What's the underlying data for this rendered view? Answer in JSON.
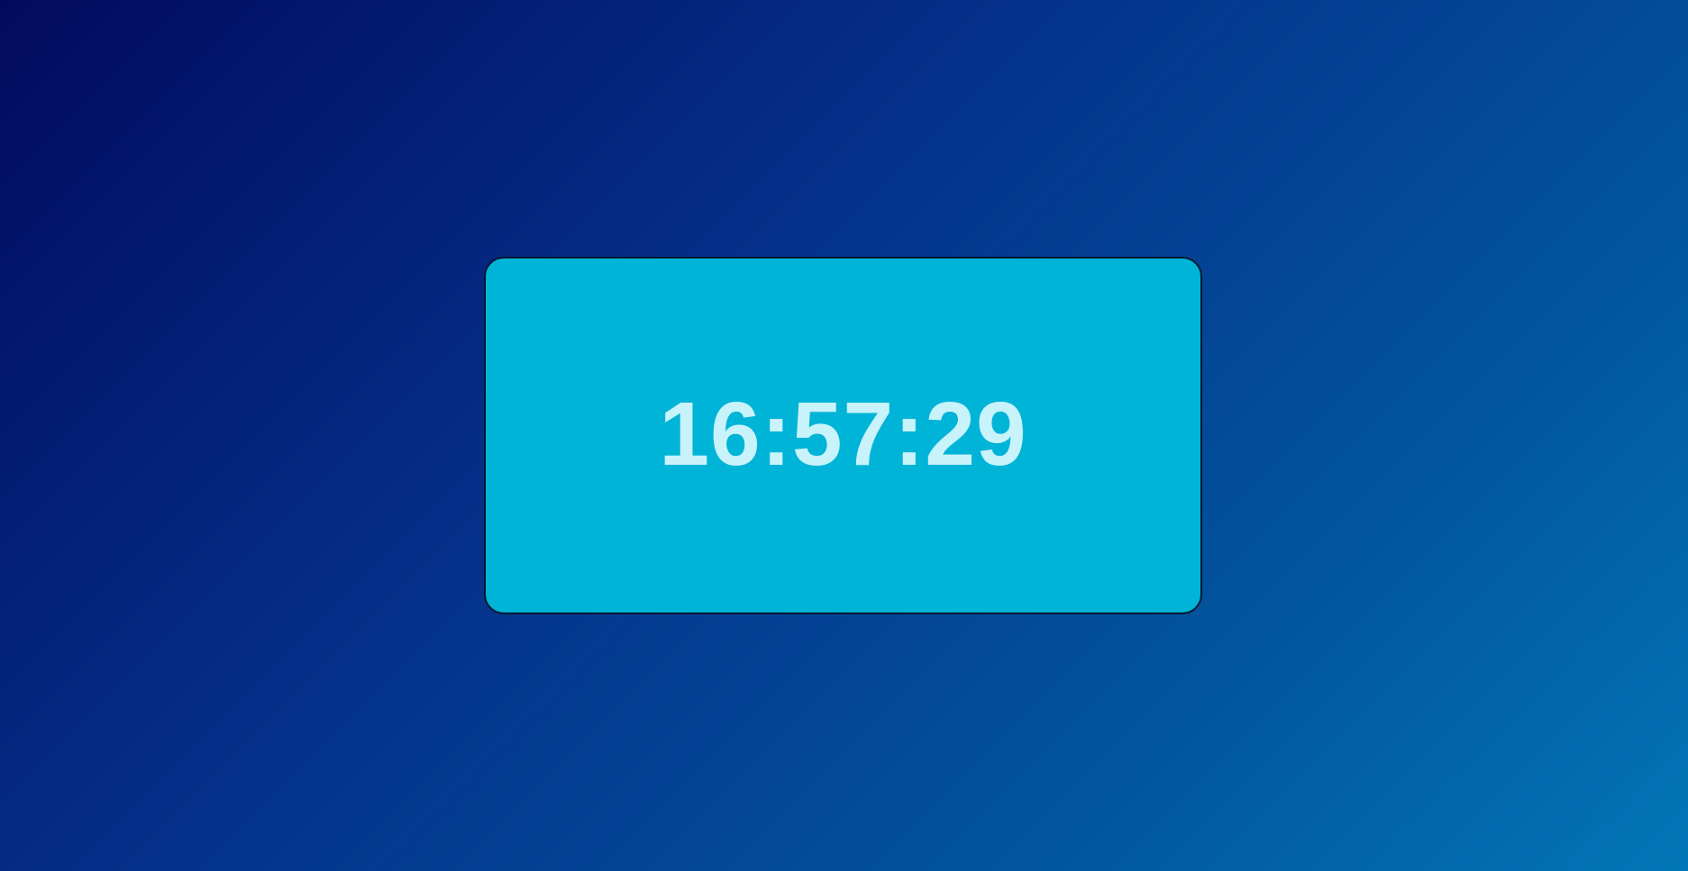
{
  "clock": {
    "time": "16:57:29"
  },
  "colors": {
    "background_start": "#020a5e",
    "background_end": "#0276b6",
    "card_background": "#00b4d8",
    "card_border": "#061833",
    "time_text": "#c9f3fa"
  }
}
